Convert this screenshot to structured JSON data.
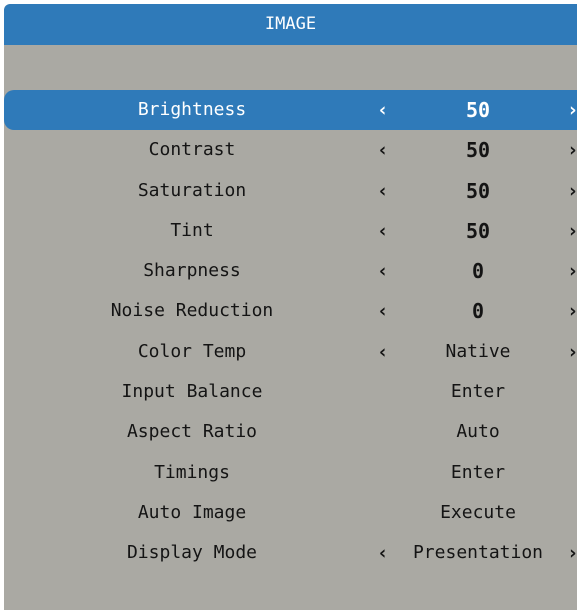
{
  "menu": {
    "title": "IMAGE",
    "rows": [
      {
        "label": "Brightness",
        "value": "50",
        "arrows": true,
        "numeric": true,
        "selected": true
      },
      {
        "label": "Contrast",
        "value": "50",
        "arrows": true,
        "numeric": true
      },
      {
        "label": "Saturation",
        "value": "50",
        "arrows": true,
        "numeric": true
      },
      {
        "label": "Tint",
        "value": "50",
        "arrows": true,
        "numeric": true
      },
      {
        "label": "Sharpness",
        "value": "0",
        "arrows": true,
        "numeric": true
      },
      {
        "label": "Noise Reduction",
        "value": "0",
        "arrows": true,
        "numeric": true
      },
      {
        "label": "Color Temp",
        "value": "Native",
        "arrows": true
      },
      {
        "label": "Input Balance",
        "value": "Enter",
        "arrows": false
      },
      {
        "label": "Aspect Ratio",
        "value": "Auto",
        "arrows": false
      },
      {
        "label": "Timings",
        "value": "Enter",
        "arrows": false
      },
      {
        "label": "Auto Image",
        "value": "Execute",
        "arrows": false
      },
      {
        "label": "Display Mode",
        "value": "Presentation",
        "arrows": true
      }
    ],
    "arrow_left_glyph": "‹",
    "arrow_right_glyph": "›"
  },
  "colors": {
    "panel_background": "#aaa9a3",
    "accent_blue": "#2f7ab9",
    "text": "#141414",
    "selected_text": "#ffffff"
  }
}
